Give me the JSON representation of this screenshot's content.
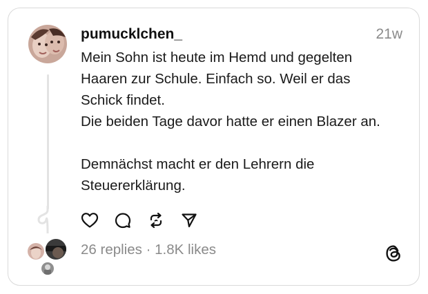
{
  "post": {
    "username": "pumucklchen_",
    "timestamp": "21w",
    "lines": [
      "Mein Sohn ist heute im Hemd und gegelten",
      "Haaren zur Schule. Einfach so. Weil er das",
      "Schick findet.",
      "Die beiden Tage davor hatte er einen Blazer an.",
      "",
      "Demnächst macht er den Lehrern die",
      "Steuererklärung."
    ],
    "stats": "26 replies · 1.8K likes"
  },
  "actions": {
    "like_icon": "heart-icon",
    "reply_icon": "comment-bubble-icon",
    "repost_icon": "repost-icon",
    "share_icon": "send-icon"
  },
  "brand": {
    "logo_icon": "threads-logo-icon"
  },
  "colors": {
    "text": "#1a1a1a",
    "muted": "#8a8a8a",
    "border": "#d9d9d9",
    "thread_line": "#e3e3e3"
  }
}
